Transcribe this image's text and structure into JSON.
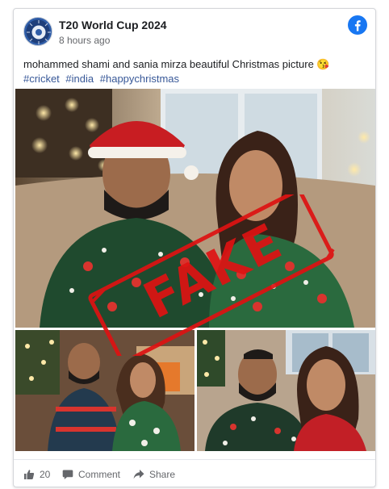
{
  "post": {
    "page_name": "T20 World Cup 2024",
    "time": "8 hours ago",
    "caption": "mohammed shami and sania mirza beautiful Christmas picture 😘",
    "hashtags": [
      "#cricket",
      "#india",
      "#happychristmas"
    ]
  },
  "stamp": {
    "text": "FAKE"
  },
  "footer": {
    "likes": "20",
    "comment": "Comment",
    "share": "Share"
  },
  "colors": {
    "facebook_blue": "#1877f2",
    "hashtag": "#385898",
    "stamp_red": "#de1212"
  },
  "icons": {
    "like": "thumbs-up-icon",
    "comment": "speech-bubble-icon",
    "share": "share-arrow-icon",
    "brand": "facebook-logo-icon"
  }
}
